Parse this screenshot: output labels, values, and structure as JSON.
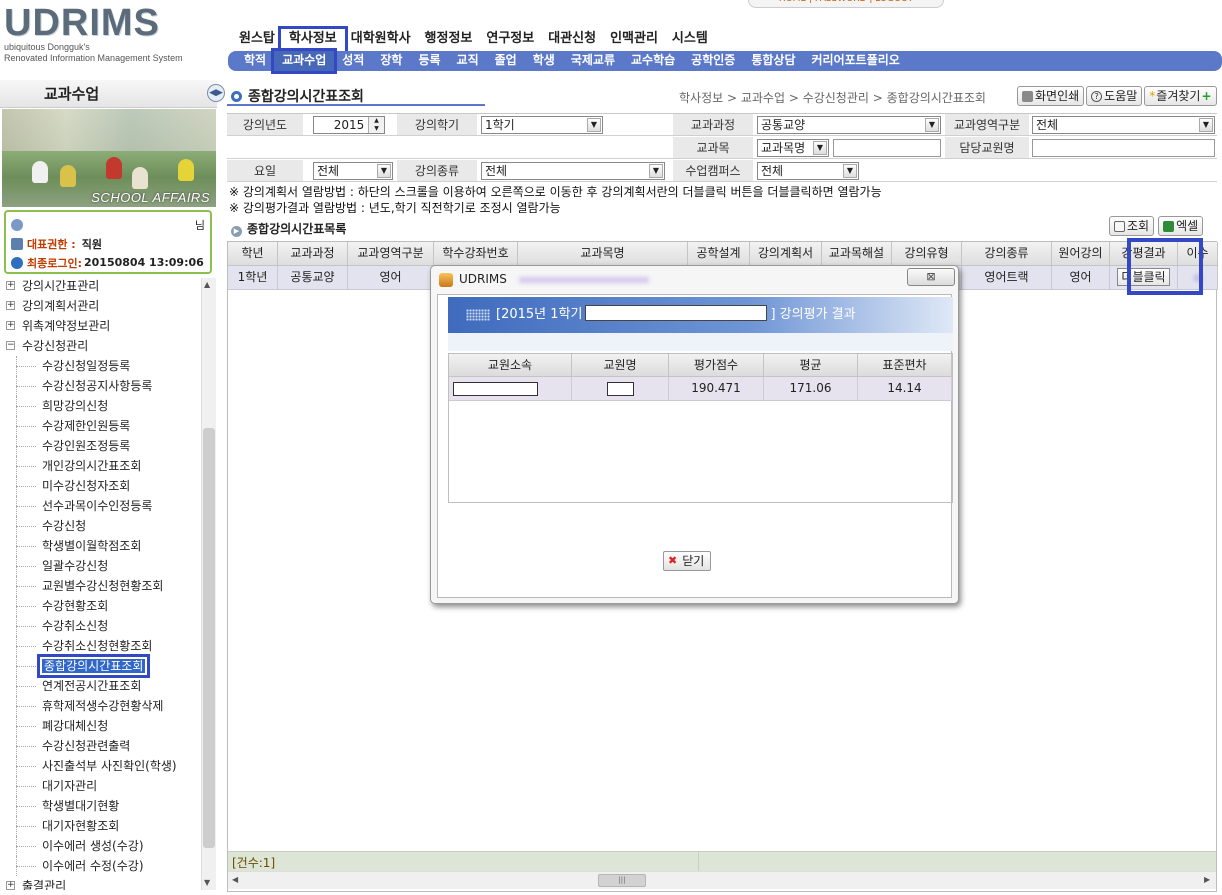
{
  "header": {
    "logo_brand": "UDRIMS",
    "logo_sub1": "ubiquitous Dongguk's",
    "logo_sub2": "Renovated Information Management System",
    "top_links": "HOME | PASSWORD | LOGOUT",
    "main_menu": [
      "원스탑",
      "학사정보",
      "대학원학사",
      "행정정보",
      "연구정보",
      "대관신청",
      "인맥관리",
      "시스템"
    ],
    "sub_menu": [
      "학적",
      "교과수업",
      "성적",
      "장학",
      "등록",
      "교직",
      "졸업",
      "학생",
      "국제교류",
      "교수학습",
      "공학인증",
      "통합상담",
      "커리어포트폴리오"
    ]
  },
  "sidebar": {
    "title": "교과수업",
    "photo_caption": "SCHOOL AFFAIRS",
    "user_suffix": "님",
    "role_label": "대표권한 :",
    "role_value": "직원",
    "last_login_label": "최종로그인:",
    "last_login_value": "20150804 13:09:06",
    "tree": [
      {
        "label": "강의시간표관리",
        "level": 0,
        "toggle": "+"
      },
      {
        "label": "강의계획서관리",
        "level": 0,
        "toggle": "+"
      },
      {
        "label": "위촉계약정보관리",
        "level": 0,
        "toggle": "+"
      },
      {
        "label": "수강신청관리",
        "level": 0,
        "toggle": "-"
      },
      {
        "label": "수강신청일정등록",
        "level": 1
      },
      {
        "label": "수강신청공지사항등록",
        "level": 1
      },
      {
        "label": "희망강의신청",
        "level": 1
      },
      {
        "label": "수강제한인원등록",
        "level": 1
      },
      {
        "label": "수강인원조정등록",
        "level": 1
      },
      {
        "label": "개인강의시간표조회",
        "level": 1
      },
      {
        "label": "미수강신청자조회",
        "level": 1
      },
      {
        "label": "선수과목이수인정등록",
        "level": 1
      },
      {
        "label": "수강신청",
        "level": 1
      },
      {
        "label": "학생별이월학점조회",
        "level": 1
      },
      {
        "label": "일괄수강신청",
        "level": 1
      },
      {
        "label": "교원별수강신청현황조회",
        "level": 1
      },
      {
        "label": "수강현황조회",
        "level": 1
      },
      {
        "label": "수강취소신청",
        "level": 1
      },
      {
        "label": "수강취소신청현황조회",
        "level": 1
      },
      {
        "label": "종합강의시간표조회",
        "level": 1,
        "selected": true
      },
      {
        "label": "연계전공시간표조회",
        "level": 1
      },
      {
        "label": "휴학제적생수강현황삭제",
        "level": 1
      },
      {
        "label": "폐강대체신청",
        "level": 1
      },
      {
        "label": "수강신청관련출력",
        "level": 1
      },
      {
        "label": "사진출석부 사진확인(학생)",
        "level": 1
      },
      {
        "label": "대기자관리",
        "level": 1
      },
      {
        "label": "학생별대기현황",
        "level": 1
      },
      {
        "label": "대기자현황조회",
        "level": 1
      },
      {
        "label": "이수에러 생성(수강)",
        "level": 1
      },
      {
        "label": "이수에러 수정(수강)",
        "level": 1
      },
      {
        "label": "출결관리",
        "level": 0,
        "toggle": "+"
      }
    ]
  },
  "main": {
    "page_title": "종합강의시간표조회",
    "breadcrumb": "학사정보 > 교과수업 > 수강신청관리 > 종합강의시간표조회",
    "buttons": {
      "print": "화면인쇄",
      "help": "도움말",
      "favorite": "즐겨찾기"
    },
    "filter": {
      "year_label": "강의년도",
      "year_value": "2015",
      "semester_label": "강의학기",
      "semester_value": "1학기",
      "course_type_label": "교과과정",
      "course_type_value": "공통교양",
      "area_label": "교과영역구분",
      "area_value": "전체",
      "subject_label": "교과목",
      "subject_select": "교과목명",
      "professor_label": "담당교원명",
      "day_label": "요일",
      "day_value": "전체",
      "kind_label": "강의종류",
      "kind_value": "전체",
      "campus_label": "수업캠퍼스",
      "campus_value": "전체"
    },
    "notes": [
      "※ 강의계획서 열람방법 : 하단의 스크롤을 이용하여 오른쪽으로 이동한 후 강의계획서란의 더블클릭 버튼을 더블클릭하면 열람가능",
      "※ 강의평가결과 열람방법 : 년도,학기 직전학기로 조정시 열람가능"
    ],
    "list_title": "종합강의시간표목록",
    "list_buttons": {
      "search": "조회",
      "excel": "엑셀"
    },
    "grid": {
      "columns": [
        "학년",
        "교과과정",
        "교과영역구분",
        "학수강좌번호",
        "교과목명",
        "공학설계",
        "강의계획서",
        "교과목해설",
        "강의유형",
        "강의종류",
        "원어강의",
        "강평결과",
        "이수"
      ],
      "row": {
        "grade": "1학년",
        "course_type": "공통교양",
        "area": "영어",
        "kind": "영어트랙",
        "native": "영어",
        "eval_button": "더블클릭"
      },
      "count": "[건수:1]"
    }
  },
  "popup": {
    "window_title": "UDRIMS",
    "header_prefix": "[2015년 1학기",
    "header_suffix": "] 강의평가 결과",
    "columns": [
      "교원소속",
      "교원명",
      "평가점수",
      "평균",
      "표준편차"
    ],
    "row": {
      "score": "190.471",
      "average": "171.06",
      "stddev": "14.14"
    },
    "close_label": "닫기"
  }
}
